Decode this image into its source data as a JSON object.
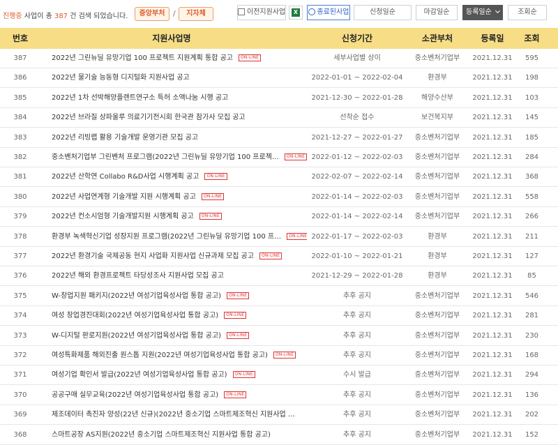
{
  "summary": {
    "prefix": "진행중",
    "middle": " 사업이 총 ",
    "count": "387",
    "suffix": " 건 검색 되었습니다."
  },
  "filters": {
    "central": "중앙부처",
    "local": "지자체",
    "separator": "/"
  },
  "toolbar": {
    "prev_programs": "이전지원사업",
    "excel": "X",
    "my_programs": "종료된사업",
    "sort_apply": "신청일순",
    "sort_deadline": "마감일순",
    "sort_registered": "등록일순",
    "sort_views": "조회순"
  },
  "table": {
    "headers": [
      "번호",
      "지원사업명",
      "신청기간",
      "소관부처",
      "등록일",
      "조회"
    ],
    "online_label": "ON-LINE",
    "rows": [
      {
        "no": "387",
        "title": "2022년 그린뉴딜 유망기업 100 프로젝트 지원계획 통합 공고",
        "online": true,
        "period": "세부사업별 상이",
        "ministry": "중소벤처기업부",
        "date": "2021.12.31",
        "views": "595"
      },
      {
        "no": "386",
        "title": "2022년 물기술 능동형 디지털화 지원사업 공고",
        "online": false,
        "period": "2022-01-01 ~ 2022-02-04",
        "ministry": "환경부",
        "date": "2021.12.31",
        "views": "198"
      },
      {
        "no": "385",
        "title": "2022년 1차 선박해양플랜트연구소 특허 소액나눔 시행 공고",
        "online": false,
        "period": "2021-12-30 ~ 2022-01-28",
        "ministry": "해양수산부",
        "date": "2021.12.31",
        "views": "103"
      },
      {
        "no": "384",
        "title": "2022년 브라질 상파울루 의료기기전시회 한국관 참가사 모집 공고",
        "online": false,
        "period": "선착순 접수",
        "ministry": "보건복지부",
        "date": "2021.12.31",
        "views": "145"
      },
      {
        "no": "383",
        "title": "2022년 리빙랩 활용 기술개발 운영기관 모집 공고",
        "online": false,
        "period": "2021-12-27 ~ 2022-01-27",
        "ministry": "중소벤처기업부",
        "date": "2021.12.31",
        "views": "185"
      },
      {
        "no": "382",
        "title": "중소벤처기업부 그린벤처 프로그램(2022년 그린뉴딜 유망기업 100 프로젝…",
        "online": true,
        "period": "2022-01-12 ~ 2022-02-03",
        "ministry": "중소벤처기업부",
        "date": "2021.12.31",
        "views": "284"
      },
      {
        "no": "381",
        "title": "2022년 산학연 Collabo R&D사업 시행계획 공고",
        "online": true,
        "period": "2022-02-07 ~ 2022-02-14",
        "ministry": "중소벤처기업부",
        "date": "2021.12.31",
        "views": "368"
      },
      {
        "no": "380",
        "title": "2022년 사업연계형 기술개발 지원 시행계획 공고",
        "online": true,
        "period": "2022-01-14 ~ 2022-02-03",
        "ministry": "중소벤처기업부",
        "date": "2021.12.31",
        "views": "558"
      },
      {
        "no": "379",
        "title": "2022년 컨소시엄형 기술개발지원 시행계획 공고",
        "online": true,
        "period": "2022-01-14 ~ 2022-02-14",
        "ministry": "중소벤처기업부",
        "date": "2021.12.31",
        "views": "266"
      },
      {
        "no": "378",
        "title": "환경부 녹색혁신기업 성장지원 프로그램(2022년 그린뉴딜 유망기업 100 프…",
        "online": true,
        "period": "2022-01-17 ~ 2022-02-03",
        "ministry": "환경부",
        "date": "2021.12.31",
        "views": "211"
      },
      {
        "no": "377",
        "title": "2022년 환경기술 국제공동 현지 사업화 지원사업 신규과제 모집 공고",
        "online": true,
        "period": "2022-01-10 ~ 2022-01-21",
        "ministry": "환경부",
        "date": "2021.12.31",
        "views": "127"
      },
      {
        "no": "376",
        "title": "2022년 해외 환경프로젝트 타당성조사 지원사업 모집 공고",
        "online": false,
        "period": "2021-12-29 ~ 2022-01-28",
        "ministry": "환경부",
        "date": "2021.12.31",
        "views": "85"
      },
      {
        "no": "375",
        "title": "W-창업지원 패키지(2022년 여성기업육성사업 통합 공고)",
        "online": true,
        "period": "추후 공지",
        "ministry": "중소벤처기업부",
        "date": "2021.12.31",
        "views": "546"
      },
      {
        "no": "374",
        "title": "여성 창업경진대회(2022년 여성기업육성사업 통합 공고)",
        "online": true,
        "period": "추후 공지",
        "ministry": "중소벤처기업부",
        "date": "2021.12.31",
        "views": "281"
      },
      {
        "no": "373",
        "title": "W-디지털 판로지원(2022년 여성기업육성사업 통합 공고)",
        "online": true,
        "period": "추후 공지",
        "ministry": "중소벤처기업부",
        "date": "2021.12.31",
        "views": "230"
      },
      {
        "no": "372",
        "title": "여성특화제품 해외진출 원스톱 지원(2022년 여성기업육성사업 통합 공고)",
        "online": true,
        "period": "추후 공지",
        "ministry": "중소벤처기업부",
        "date": "2021.12.31",
        "views": "168"
      },
      {
        "no": "371",
        "title": "여성기업 확인서 발급(2022년 여성기업육성사업 통합 공고)",
        "online": true,
        "period": "수시 발급",
        "ministry": "중소벤처기업부",
        "date": "2021.12.31",
        "views": "294"
      },
      {
        "no": "370",
        "title": "공공구매 실무교육(2022년 여성기업육성사업 통합 공고)",
        "online": true,
        "period": "추후 공지",
        "ministry": "중소벤처기업부",
        "date": "2021.12.31",
        "views": "136"
      },
      {
        "no": "369",
        "title": "제조데이터 촉진자 양성(22년 신규)(2022년 중소기업 스마트제조혁신 지원사업 …",
        "online": false,
        "period": "추후 공지",
        "ministry": "중소벤처기업부",
        "date": "2021.12.31",
        "views": "202"
      },
      {
        "no": "368",
        "title": "스마트공장 AS지원(2022년 중소기업 스마트제조혁신 지원사업 통합 공고)",
        "online": false,
        "period": "추후 공지",
        "ministry": "중소벤처기업부",
        "date": "2021.12.31",
        "views": "152"
      }
    ]
  }
}
